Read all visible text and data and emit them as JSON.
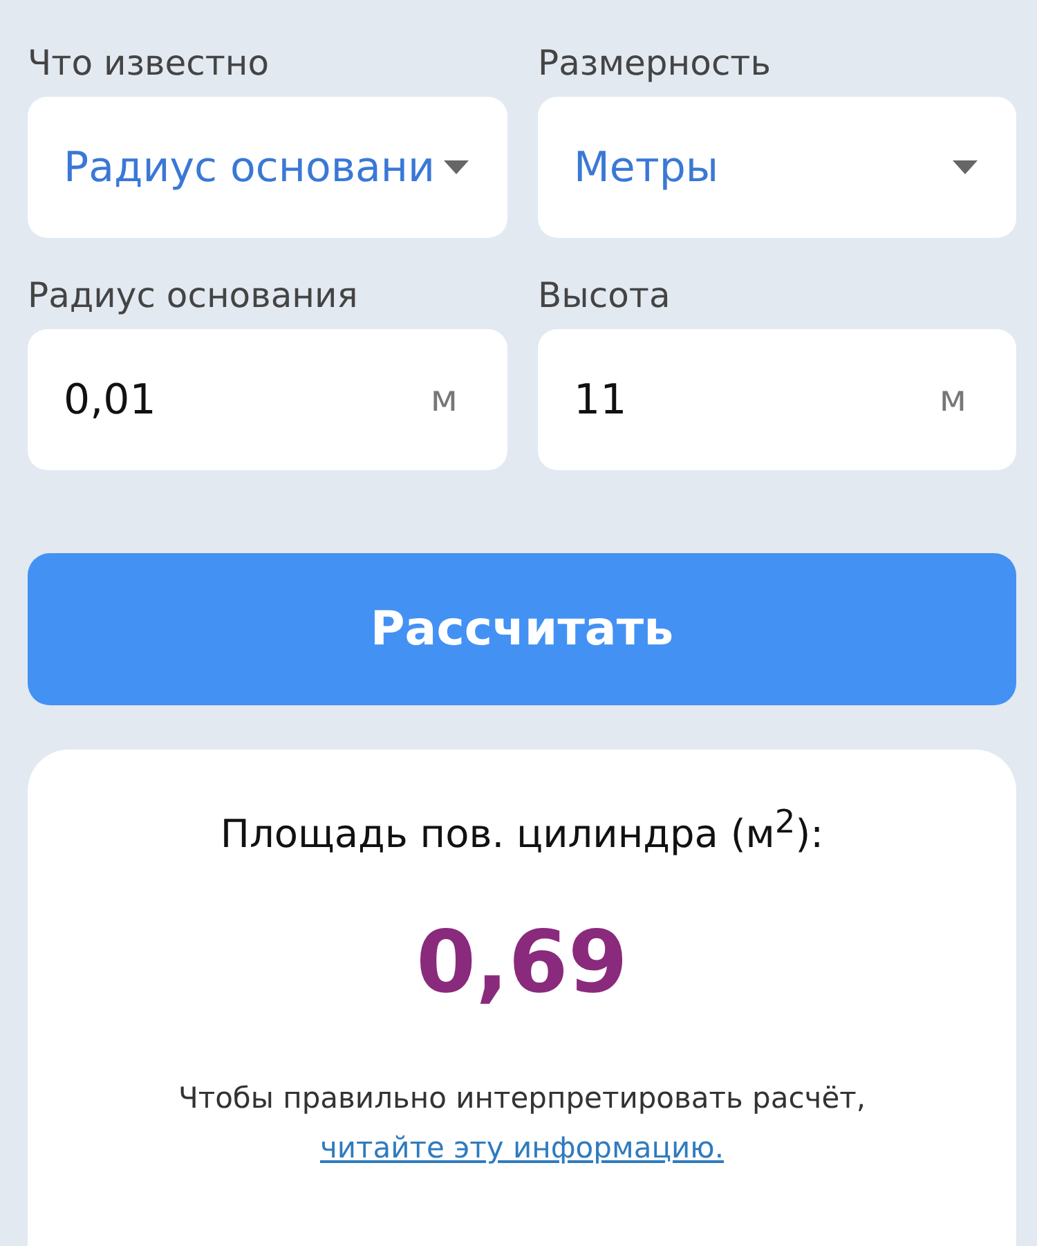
{
  "fields": [
    {
      "kind": "select",
      "label": "Что известно",
      "value": "Радиус основани"
    },
    {
      "kind": "select",
      "label": "Размерность",
      "value": "Метры"
    },
    {
      "kind": "input",
      "label": "Радиус основания",
      "value": "0,01",
      "unit": "м"
    },
    {
      "kind": "input",
      "label": "Высота",
      "value": "11",
      "unit": "м"
    }
  ],
  "button": "Рассчитать",
  "result": {
    "title": "Площадь пов. цилиндра (м$^{2}$):",
    "value": "0,69",
    "note": "Чтобы правильно интерпретировать расчёт,",
    "link": "читайте эту информацию."
  }
}
